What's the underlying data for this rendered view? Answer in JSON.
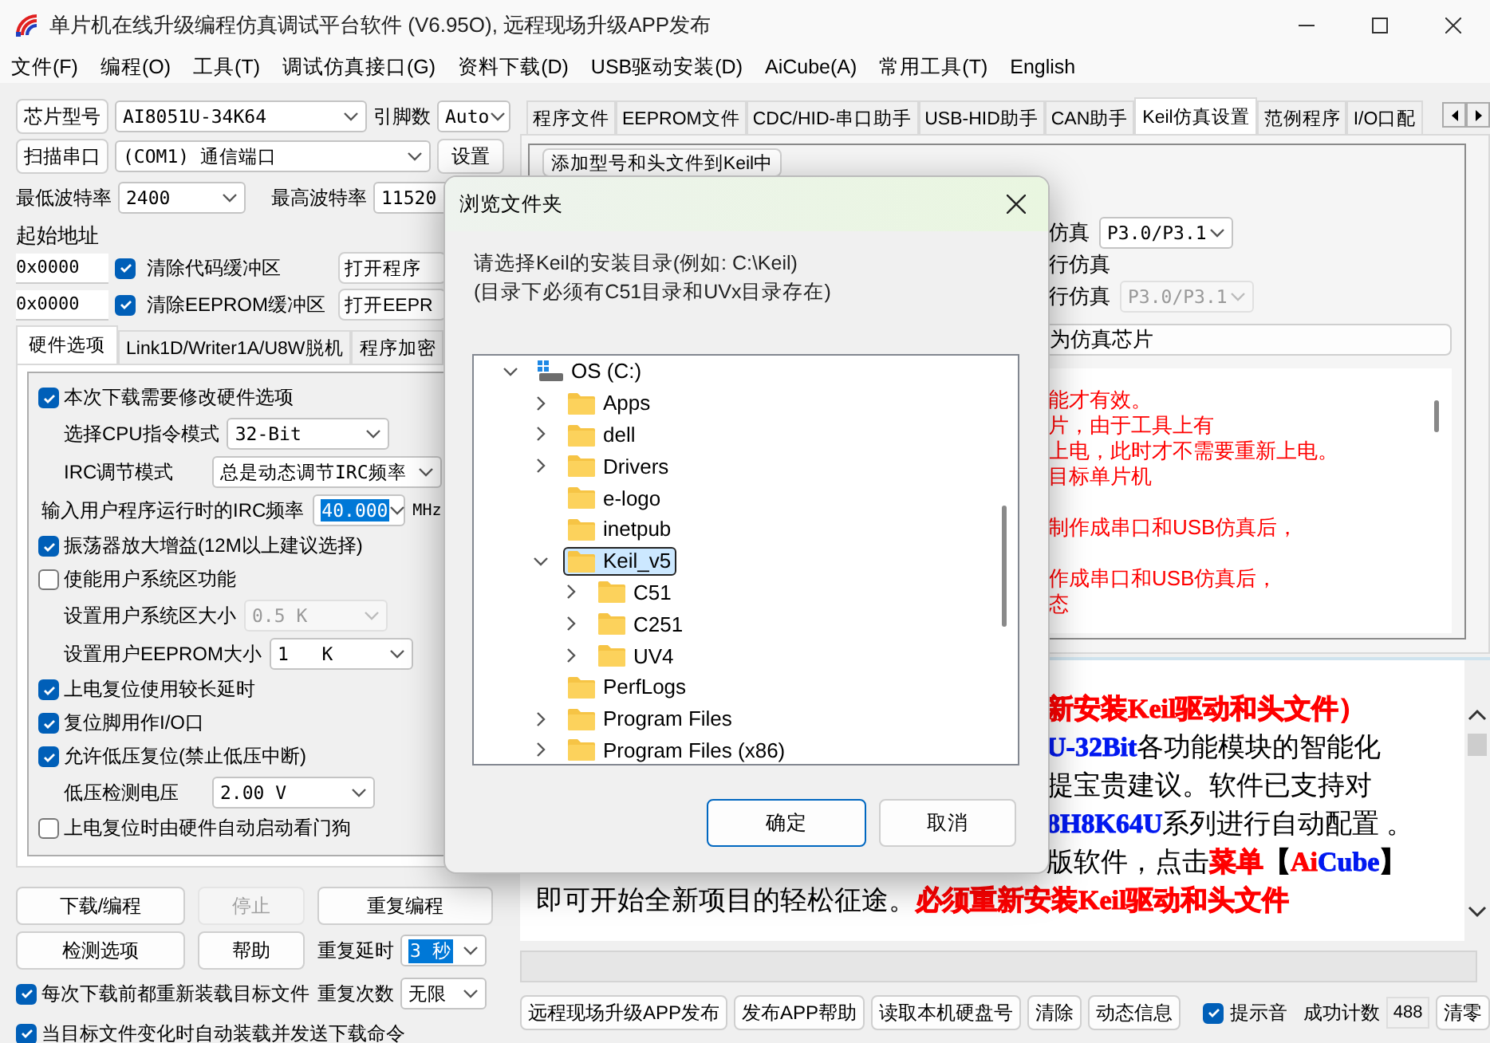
{
  "window": {
    "title": "单片机在线升级编程仿真调试平台软件 (V6.95O), 远程现场升级APP发布"
  },
  "menu": [
    "文件(F)",
    "编程(O)",
    "工具(T)",
    "调试仿真接口(G)",
    "资料下载(D)",
    "USB驱动安装(D)",
    "AiCube(A)",
    "常用工具(T)",
    "English"
  ],
  "chip_row": {
    "button": "芯片型号",
    "chip": "AI8051U-34K64",
    "pins_label": "引脚数",
    "pins": "Auto"
  },
  "port_row": {
    "button": "扫描串口",
    "port": "(COM1) 通信端口",
    "settings": "设置"
  },
  "baud": {
    "min_label": "最低波特率",
    "min": "2400",
    "max_label": "最高波特率",
    "max": "11520"
  },
  "start_address_label": "起始地址",
  "buffers": [
    {
      "address": "0x0000",
      "label": "清除代码缓冲区",
      "checked": true,
      "open_button": "打开程序"
    },
    {
      "address": "0x0000",
      "label": "清除EEPROM缓冲区",
      "checked": true,
      "open_button": "打开EEPR"
    }
  ],
  "left_tabs": [
    {
      "label": "硬件选项",
      "selected": true
    },
    {
      "label": "Link1D/Writer1A/U8W脱机",
      "selected": false
    },
    {
      "label": "程序加密",
      "selected": false
    }
  ],
  "hardware_options": [
    {
      "kind": "checkbox",
      "label": "本次下载需要修改硬件选项",
      "checked": true
    },
    {
      "kind": "select",
      "label": "选择CPU指令模式",
      "value": "32-Bit",
      "disabled": false
    },
    {
      "kind": "select",
      "label": "IRC调节模式",
      "value": "总是动态调节IRC频率",
      "disabled": false
    },
    {
      "kind": "input",
      "label": "输入用户程序运行时的IRC频率",
      "value": "40.000",
      "unit": "MHz",
      "highlighted": true
    },
    {
      "kind": "checkbox",
      "label": "振荡器放大增益(12M以上建议选择)",
      "checked": true
    },
    {
      "kind": "checkbox",
      "label": "使能用户系统区功能",
      "checked": false
    },
    {
      "kind": "select",
      "label": "设置用户系统区大小",
      "value": "0.5 K",
      "disabled": true
    },
    {
      "kind": "select",
      "label": "设置用户EEPROM大小",
      "value": "1   K",
      "disabled": false
    },
    {
      "kind": "checkbox",
      "label": "上电复位使用较长延时",
      "checked": true
    },
    {
      "kind": "checkbox",
      "label": "复位脚用作I/O口",
      "checked": true
    },
    {
      "kind": "checkbox",
      "label": "允许低压复位(禁止低压中断)",
      "checked": true
    },
    {
      "kind": "select",
      "label": "低压检测电压",
      "value": "2.00 V",
      "disabled": false
    },
    {
      "kind": "checkbox",
      "label": "上电复位时由硬件自动启动看门狗",
      "checked": false
    }
  ],
  "actions": [
    {
      "label": "下载/编程",
      "disabled": false
    },
    {
      "label": "停止",
      "disabled": true
    },
    {
      "label": "重复编程",
      "disabled": false
    },
    {
      "label": "检测选项",
      "disabled": false
    },
    {
      "label": "帮助",
      "disabled": false
    }
  ],
  "repeat": [
    {
      "label": "重复延时",
      "value": "3 秒",
      "highlighted": true
    },
    {
      "label": "重复次数",
      "value": "无限",
      "highlighted": false
    }
  ],
  "auto_options": [
    {
      "label": "每次下载前都重新装载目标文件",
      "checked": true
    },
    {
      "label": "当目标文件变化时自动装载并发送下载命令",
      "checked": true
    }
  ],
  "right_tabs": [
    {
      "label": "程序文件",
      "selected": false
    },
    {
      "label": "EEPROM文件",
      "selected": false
    },
    {
      "label": "CDC/HID-串口助手",
      "selected": false
    },
    {
      "label": "USB-HID助手",
      "selected": false
    },
    {
      "label": "CAN助手",
      "selected": false
    },
    {
      "label": "Keil仿真设置",
      "selected": true
    },
    {
      "label": "范例程序",
      "selected": false
    },
    {
      "label": "I/O口配",
      "selected": false
    }
  ],
  "keil_page": {
    "add_button": "添加型号和头文件到Keil中",
    "rows": [
      {
        "kind": "select",
        "label": "仿真",
        "value": "P3.0/P3.1",
        "disabled": false
      },
      {
        "kind": "text",
        "label": "行仿真"
      },
      {
        "kind": "select",
        "label": "行仿真",
        "value": "P3.0/P3.1",
        "disabled": true
      }
    ],
    "chip_button": "为仿真芯片",
    "notes": [
      {
        "text": "能才有效。",
        "gap_before": false
      },
      {
        "text": "片，由于工具上有",
        "gap_before": false
      },
      {
        "text": "上电，此时才不需要重新上电。",
        "gap_before": false
      },
      {
        "text": "目标单片机",
        "gap_before": false
      },
      {
        "text": "制作成串口和USB仿真后，",
        "gap_before": true
      },
      {
        "text": "作成串口和USB仿真后，",
        "gap_before": true
      },
      {
        "text": "态",
        "gap_before": false
      }
    ]
  },
  "log": {
    "lines": [
      {
        "partial": true,
        "segments": [
          {
            "text": "新安装Keil驱动和头文件）",
            "color": "#ff0000",
            "bold": true
          }
        ]
      },
      {
        "partial": true,
        "segments": [
          {
            "text": "U-32Bit",
            "color": "#0018f0",
            "bold": true
          },
          {
            "text": "各功能模块的智能化",
            "color": "#000000",
            "bold": false
          }
        ]
      },
      {
        "partial": true,
        "segments": [
          {
            "text": "提宝贵建议。软件已支持对",
            "color": "#000000",
            "bold": false
          }
        ]
      },
      {
        "partial": true,
        "segments": [
          {
            "text": "8H8K64U",
            "color": "#0018f0",
            "bold": true
          },
          {
            "text": "系列进行自动配置 。",
            "color": "#000000",
            "bold": false
          }
        ]
      },
      {
        "partial": true,
        "segments": [
          {
            "text": "版软件，点击",
            "color": "#000000",
            "bold": false
          },
          {
            "text": "菜单",
            "color": "#ff0000",
            "bold": true
          },
          {
            "text": "【",
            "color": "#000000",
            "bold": true
          },
          {
            "text": "Ai",
            "color": "#ff0000",
            "bold": true
          },
          {
            "text": "Cube",
            "color": "#0018f0",
            "bold": true
          },
          {
            "text": "】",
            "color": "#000000",
            "bold": true
          }
        ]
      },
      {
        "partial": false,
        "segments": [
          {
            "text": "即可开始全新项目的轻松征途。",
            "color": "#000000",
            "bold": false
          },
          {
            "text": "必须重新安装Keil驱动和头文件",
            "color": "#ff0000",
            "bold": true
          }
        ]
      }
    ]
  },
  "progress": {
    "level": 0
  },
  "bottom_bar": {
    "buttons": [
      "远程现场升级APP发布",
      "发布APP帮助",
      "读取本机硬盘号",
      "清除",
      "动态信息"
    ],
    "sound": {
      "label": "提示音",
      "checked": true
    },
    "count_label": "成功计数",
    "count": "488",
    "reset": "清零"
  },
  "dialog": {
    "title": "浏览文件夹",
    "prompt": [
      "请选择Keil的安装目录(例如: C:\\Keil)",
      "(目录下必须有C51目录和UVx目录存在)"
    ],
    "tree": [
      {
        "name": "OS (C:)",
        "kind": "drive",
        "expandable": true,
        "expanded": true,
        "selected": false,
        "children": [
          {
            "name": "Apps",
            "kind": "folder",
            "expandable": true,
            "expanded": false,
            "selected": false
          },
          {
            "name": "dell",
            "kind": "folder",
            "expandable": true,
            "expanded": false,
            "selected": false
          },
          {
            "name": "Drivers",
            "kind": "folder",
            "expandable": true,
            "expanded": false,
            "selected": false
          },
          {
            "name": "e-logo",
            "kind": "folder",
            "expandable": false,
            "expanded": false,
            "selected": false
          },
          {
            "name": "inetpub",
            "kind": "folder",
            "expandable": false,
            "expanded": false,
            "selected": false
          },
          {
            "name": "Keil_v5",
            "kind": "folder",
            "expandable": true,
            "expanded": true,
            "selected": true,
            "children": [
              {
                "name": "C51",
                "kind": "folder",
                "expandable": true,
                "expanded": false,
                "selected": false
              },
              {
                "name": "C251",
                "kind": "folder",
                "expandable": true,
                "expanded": false,
                "selected": false
              },
              {
                "name": "UV4",
                "kind": "folder",
                "expandable": true,
                "expanded": false,
                "selected": false
              }
            ]
          },
          {
            "name": "PerfLogs",
            "kind": "folder",
            "expandable": false,
            "expanded": false,
            "selected": false
          },
          {
            "name": "Program Files",
            "kind": "folder",
            "expandable": true,
            "expanded": false,
            "selected": false
          },
          {
            "name": "Program Files (x86)",
            "kind": "folder",
            "expandable": true,
            "expanded": false,
            "selected": false
          }
        ]
      }
    ],
    "buttons": [
      {
        "label": "确定",
        "default": true
      },
      {
        "label": "取消",
        "default": false
      }
    ]
  }
}
